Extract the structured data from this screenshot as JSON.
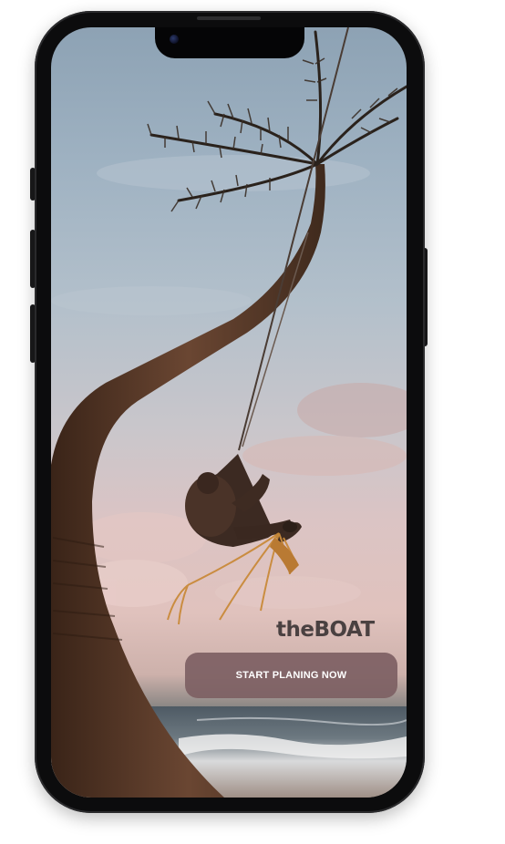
{
  "app": {
    "brand_name": "theBOAT",
    "cta_label": "START PLANING NOW"
  },
  "colors": {
    "cta_background": "#7d5f63",
    "brand_text": "#4a4141",
    "phone_frame": "#0c0c0d"
  },
  "image": {
    "subject": "person swinging on rope from palm tree over beach at dusk"
  }
}
